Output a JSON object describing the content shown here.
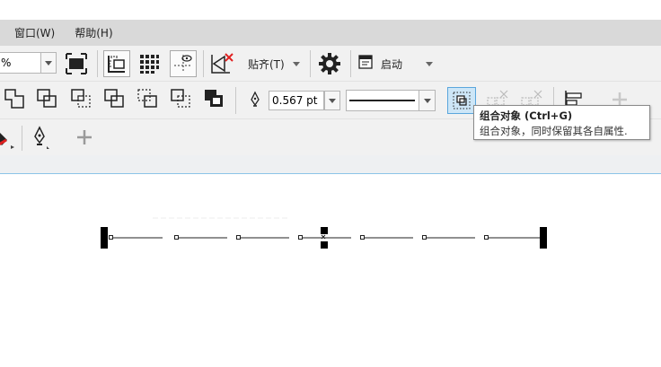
{
  "menu": {
    "window": "窗口(W)",
    "help": "帮助(H)"
  },
  "toolbar1": {
    "zoom_value": "%",
    "snap_label": "贴齐(T)",
    "launch_label": "启动"
  },
  "toolbar2": {
    "outline_width": "0.567 pt"
  },
  "tooltip": {
    "title": "组合对象 (Ctrl+G)",
    "description": "组合对象，同时保留其各自属性."
  },
  "icons": {
    "full_screen": "full-screen-icon",
    "rulers": "rulers-icon",
    "grid": "grid-icon",
    "guidelines": "guidelines-icon",
    "snap_off": "snap-off-icon",
    "options": "gear-icon",
    "launch": "launch-icon",
    "group": "group-objects-icon",
    "ungroup": "ungroup-icon",
    "ungroup_all": "ungroup-all-icon",
    "align": "align-icon",
    "add": "plus-icon",
    "pen": "pen-icon"
  },
  "colors": {
    "accent": "#5aa6dd",
    "menubar": "#d9d9d9",
    "toolbar": "#f1f1f1",
    "selection_fill": "#cde6f7"
  }
}
